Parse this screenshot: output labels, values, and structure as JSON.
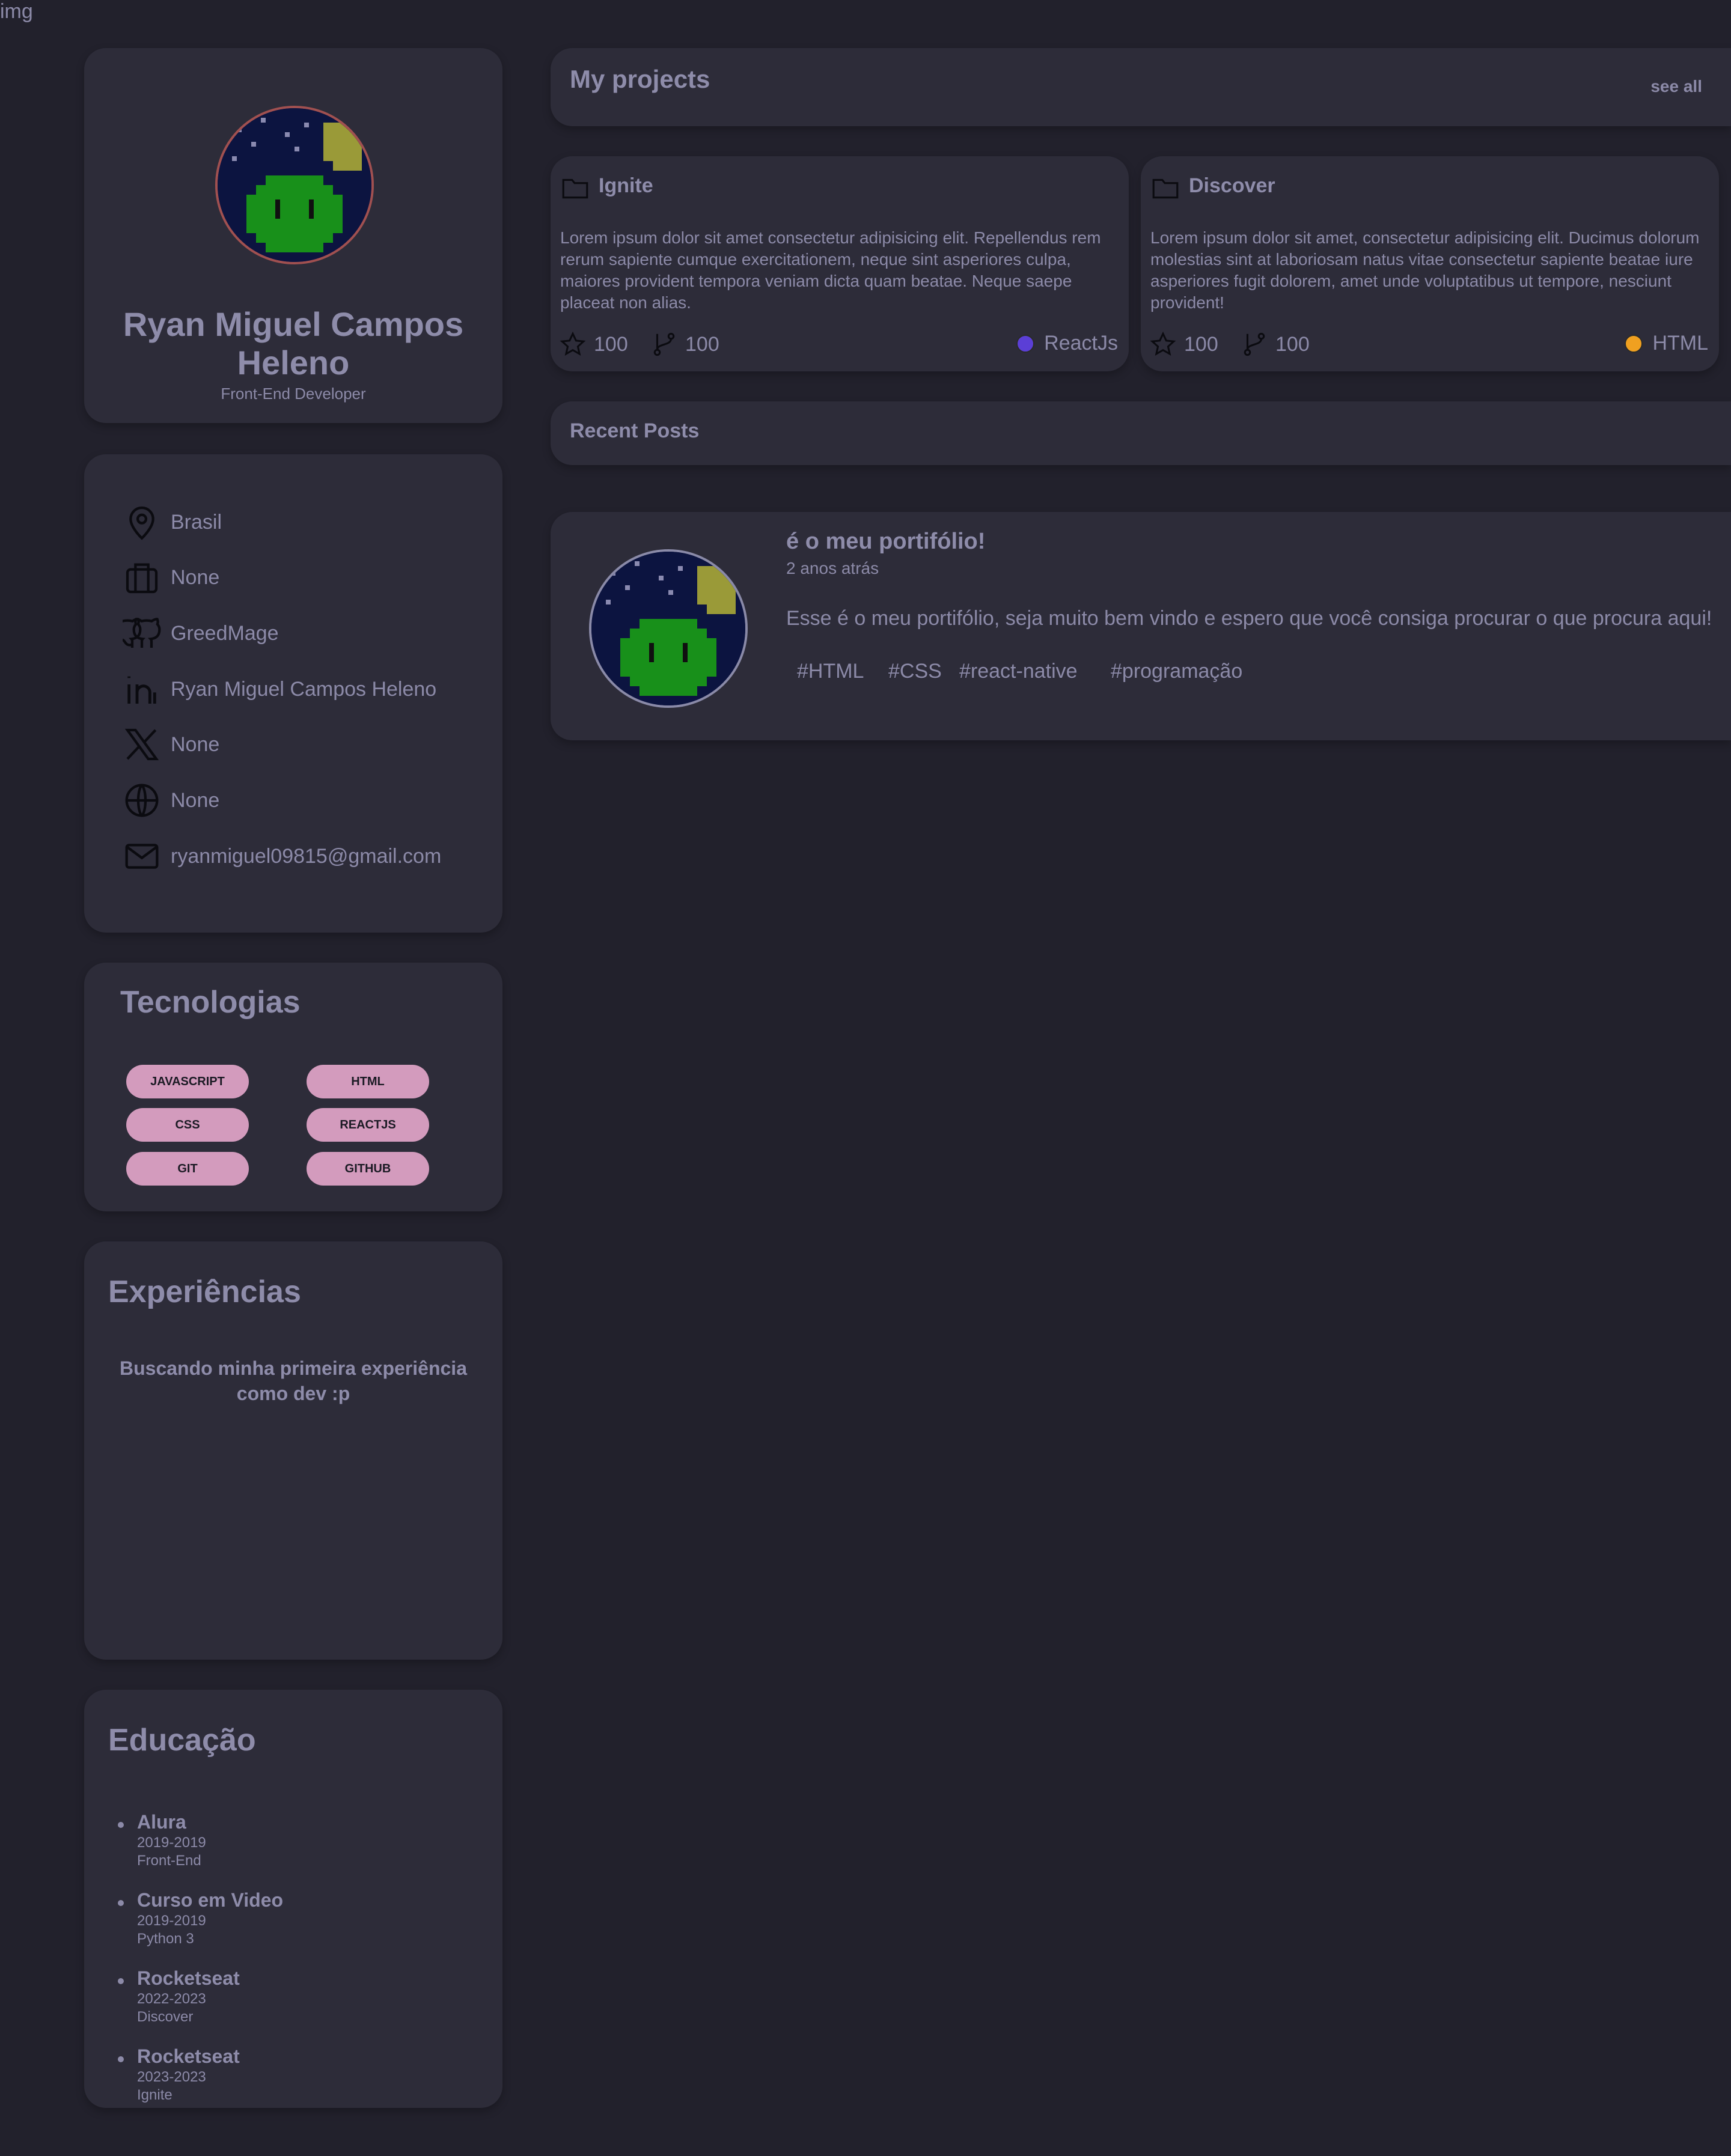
{
  "image_label": "img",
  "profile": {
    "name": "Ryan Miguel Campos Heleno",
    "role": "Front-End Developer"
  },
  "info": [
    {
      "icon": "location-pin-icon",
      "text": "Brasil"
    },
    {
      "icon": "briefcase-icon",
      "text": "None"
    },
    {
      "icon": "github-icon",
      "text": "GreedMage"
    },
    {
      "icon": "linkedin-icon",
      "text": "Ryan Miguel Campos Heleno"
    },
    {
      "icon": "x-twitter-icon",
      "text": "None"
    },
    {
      "icon": "globe-icon",
      "text": "None"
    },
    {
      "icon": "mail-icon",
      "text": "ryanmiguel09815@gmail.com"
    }
  ],
  "tech": {
    "title": "Tecnologias",
    "items": [
      "JAVASCRIPT",
      "HTML",
      "CSS",
      "REACTJS",
      "GIT",
      "GITHUB"
    ]
  },
  "experience": {
    "title": "Experiências",
    "text": "Buscando minha primeira experiência como dev :p"
  },
  "education": {
    "title": "Educação",
    "items": [
      {
        "name": "Alura",
        "years": "2019-2019",
        "course": "Front-End"
      },
      {
        "name": "Curso em Video",
        "years": "2019-2019",
        "course": "Python 3"
      },
      {
        "name": "Rocketseat",
        "years": "2022-2023",
        "course": "Discover"
      },
      {
        "name": "Rocketseat",
        "years": "2023-2023",
        "course": "Ignite"
      }
    ]
  },
  "projects": {
    "title": "My projects",
    "see_all": "see all",
    "items": [
      {
        "name": "Ignite",
        "description": "Lorem ipsum dolor sit amet consectetur adipisicing elit. Repellendus rem rerum sapiente cumque exercitationem, neque sint asperiores culpa, maiores provident tempora veniam dicta quam beatae. Neque saepe placeat non alias.",
        "stars": "100",
        "forks": "100",
        "language": "ReactJs",
        "language_color": "#5b3fd6"
      },
      {
        "name": "Discover",
        "description": "Lorem ipsum dolor sit amet, consectetur adipisicing elit. Ducimus dolorum molestias sint at laboriosam natus vitae consectetur sapiente beatae iure asperiores fugit dolorem, amet unde voluptatibus ut tempore, nesciunt provident!",
        "stars": "100",
        "forks": "100",
        "language": "HTML",
        "language_color": "#f0a020"
      }
    ]
  },
  "recent_posts": {
    "title": "Recent Posts",
    "post": {
      "title": "é o meu portifólio!",
      "time": "2 anos atrás",
      "body": "Esse é o meu portifólio, seja muito bem vindo e espero que você consiga procurar o que procura aqui!",
      "tags": [
        "#HTML",
        "#CSS",
        "#react-native",
        "#programação"
      ]
    }
  }
}
